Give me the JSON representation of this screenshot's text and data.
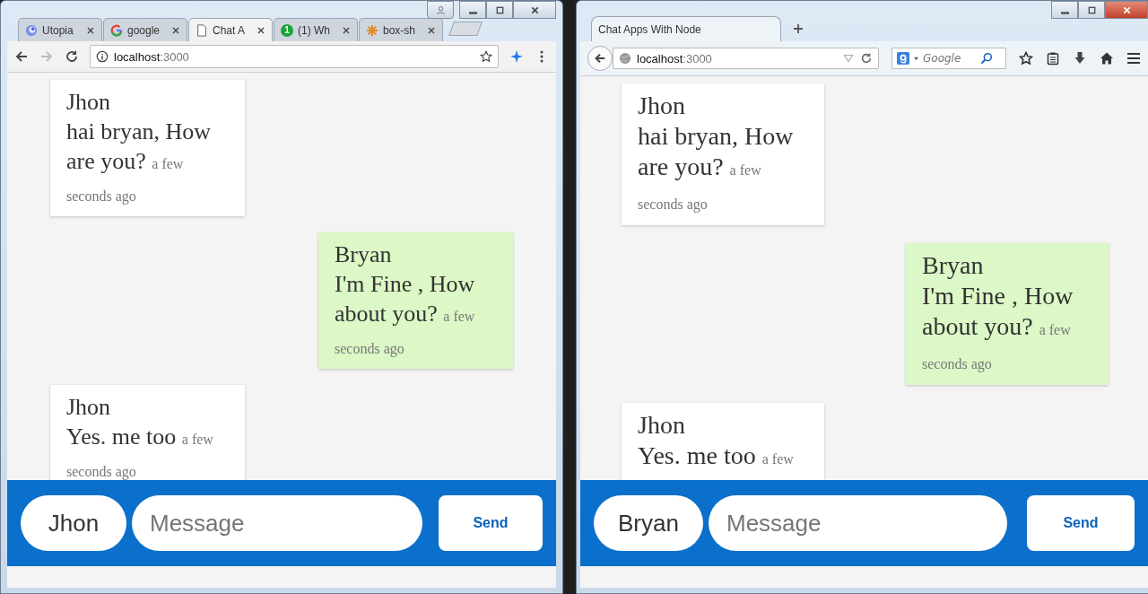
{
  "windows": [
    {
      "kind": "chrome",
      "tabs": [
        {
          "label": "Utopia",
          "kind": "swirl",
          "selected": false
        },
        {
          "label": "google",
          "kind": "ring",
          "selected": false
        },
        {
          "label": "Chat A",
          "kind": "page",
          "selected": true
        },
        {
          "label": "(1) Wh",
          "kind": "badge",
          "badge": "1",
          "selected": false
        },
        {
          "label": "box-sh",
          "kind": "asterisk",
          "selected": false
        }
      ],
      "address": {
        "host": "localhost",
        "port": ":3000"
      },
      "messages": [
        {
          "sender": "Jhon",
          "text": "hai bryan, How are you?",
          "time": "a few seconds ago",
          "own": false
        },
        {
          "sender": "Bryan",
          "text": "I'm Fine , How about you?",
          "time": "a few seconds ago",
          "own": true
        },
        {
          "sender": "Jhon",
          "text": "Yes. me too",
          "time": "a few seconds ago",
          "own": false
        }
      ],
      "composer": {
        "name": "Jhon",
        "placeholder": "Message",
        "button": "Send"
      }
    },
    {
      "kind": "firefox",
      "tabs": [
        {
          "label": "Chat Apps With Node",
          "selected": true
        }
      ],
      "address": {
        "host": "localhost",
        "port": ":3000"
      },
      "search": {
        "placeholder": "Google"
      },
      "messages": [
        {
          "sender": "Jhon",
          "text": "hai bryan, How are you?",
          "time": "a few seconds ago",
          "own": false
        },
        {
          "sender": "Bryan",
          "text": "I'm Fine , How about you?",
          "time": "a few seconds ago",
          "own": true
        },
        {
          "sender": "Jhon",
          "text": "Yes. me too",
          "time": "a few",
          "own": false
        }
      ],
      "composer": {
        "name": "Bryan",
        "placeholder": "Message",
        "button": "Send"
      }
    }
  ]
}
